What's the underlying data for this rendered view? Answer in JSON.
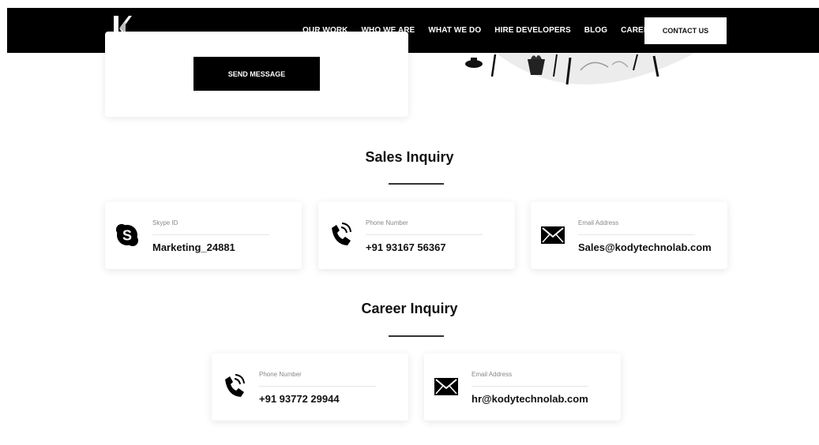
{
  "nav": {
    "links": [
      "OUR WORK",
      "WHO WE ARE",
      "WHAT WE DO",
      "HIRE DEVELOPERS",
      "BLOG",
      "CAREER"
    ],
    "contact_label": "CONTACT US"
  },
  "form": {
    "send_label": "SEND MESSAGE"
  },
  "sales": {
    "title": "Sales Inquiry",
    "cards": [
      {
        "icon": "skype-icon",
        "label": "Skype ID",
        "value": "Marketing_24881"
      },
      {
        "icon": "phone-icon",
        "label": "Phone Number",
        "value": "+91 93167 56367"
      },
      {
        "icon": "mail-icon",
        "label": "Email Address",
        "value": "Sales@kodytechnolab.com"
      }
    ]
  },
  "career": {
    "title": "Career Inquiry",
    "cards": [
      {
        "icon": "phone-icon",
        "label": "Phone Number",
        "value": "+91 93772 29944"
      },
      {
        "icon": "mail-icon",
        "label": "Email Address",
        "value": "hr@kodytechnolab.com"
      }
    ]
  }
}
